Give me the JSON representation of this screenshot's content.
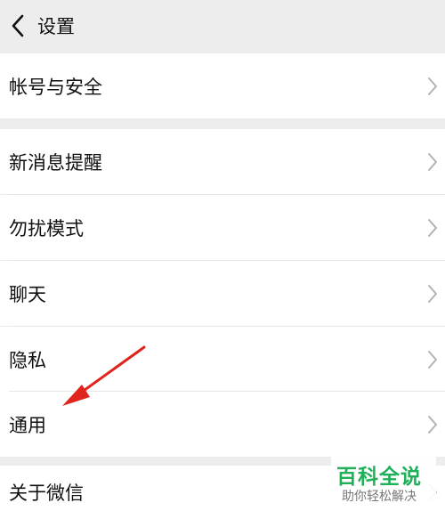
{
  "header": {
    "title": "设置",
    "back_icon": "chevron-left-icon"
  },
  "settings": {
    "items": [
      {
        "label": "帐号与安全",
        "icon": "chevron-right-icon"
      },
      {
        "label": "新消息提醒",
        "icon": "chevron-right-icon"
      },
      {
        "label": "勿扰模式",
        "icon": "chevron-right-icon"
      },
      {
        "label": "聊天",
        "icon": "chevron-right-icon"
      },
      {
        "label": "隐私",
        "icon": "chevron-right-icon"
      },
      {
        "label": "通用",
        "icon": "chevron-right-icon"
      },
      {
        "label": "关于微信",
        "icon": "chevron-right-icon"
      }
    ]
  },
  "annotation": {
    "color": "#e0231c",
    "target": "通用"
  },
  "watermark": {
    "title": "百科全说",
    "subtitle": "助你轻松解决",
    "color": "#20b05a"
  }
}
